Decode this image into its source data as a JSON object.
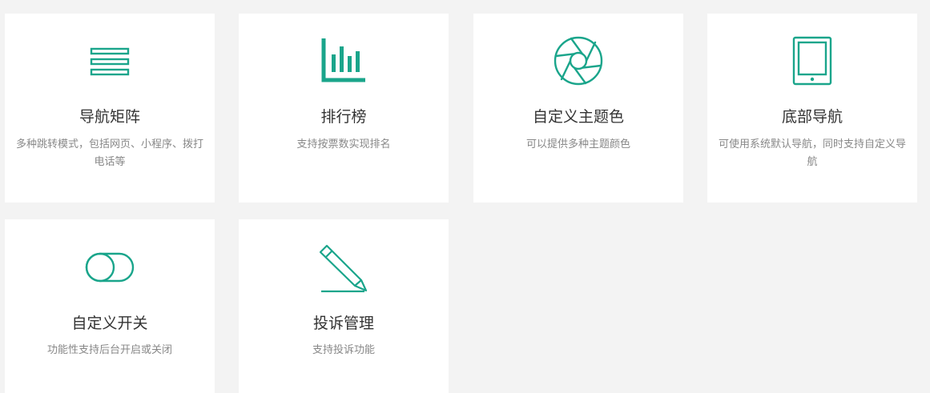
{
  "accent_color": "#1aa58b",
  "features": [
    {
      "icon": "menu-lines-icon",
      "title": "导航矩阵",
      "desc": "多种跳转模式，包括网页、小程序、拨打电话等"
    },
    {
      "icon": "bar-chart-icon",
      "title": "排行榜",
      "desc": "支持按票数实现排名"
    },
    {
      "icon": "aperture-icon",
      "title": "自定义主题色",
      "desc": "可以提供多种主题颜色"
    },
    {
      "icon": "tablet-icon",
      "title": "底部导航",
      "desc": "可使用系统默认导航，同时支持自定义导航"
    },
    {
      "icon": "toggle-icon",
      "title": "自定义开关",
      "desc": "功能性支持后台开启或关闭"
    },
    {
      "icon": "pencil-icon",
      "title": "投诉管理",
      "desc": "支持投诉功能"
    }
  ]
}
